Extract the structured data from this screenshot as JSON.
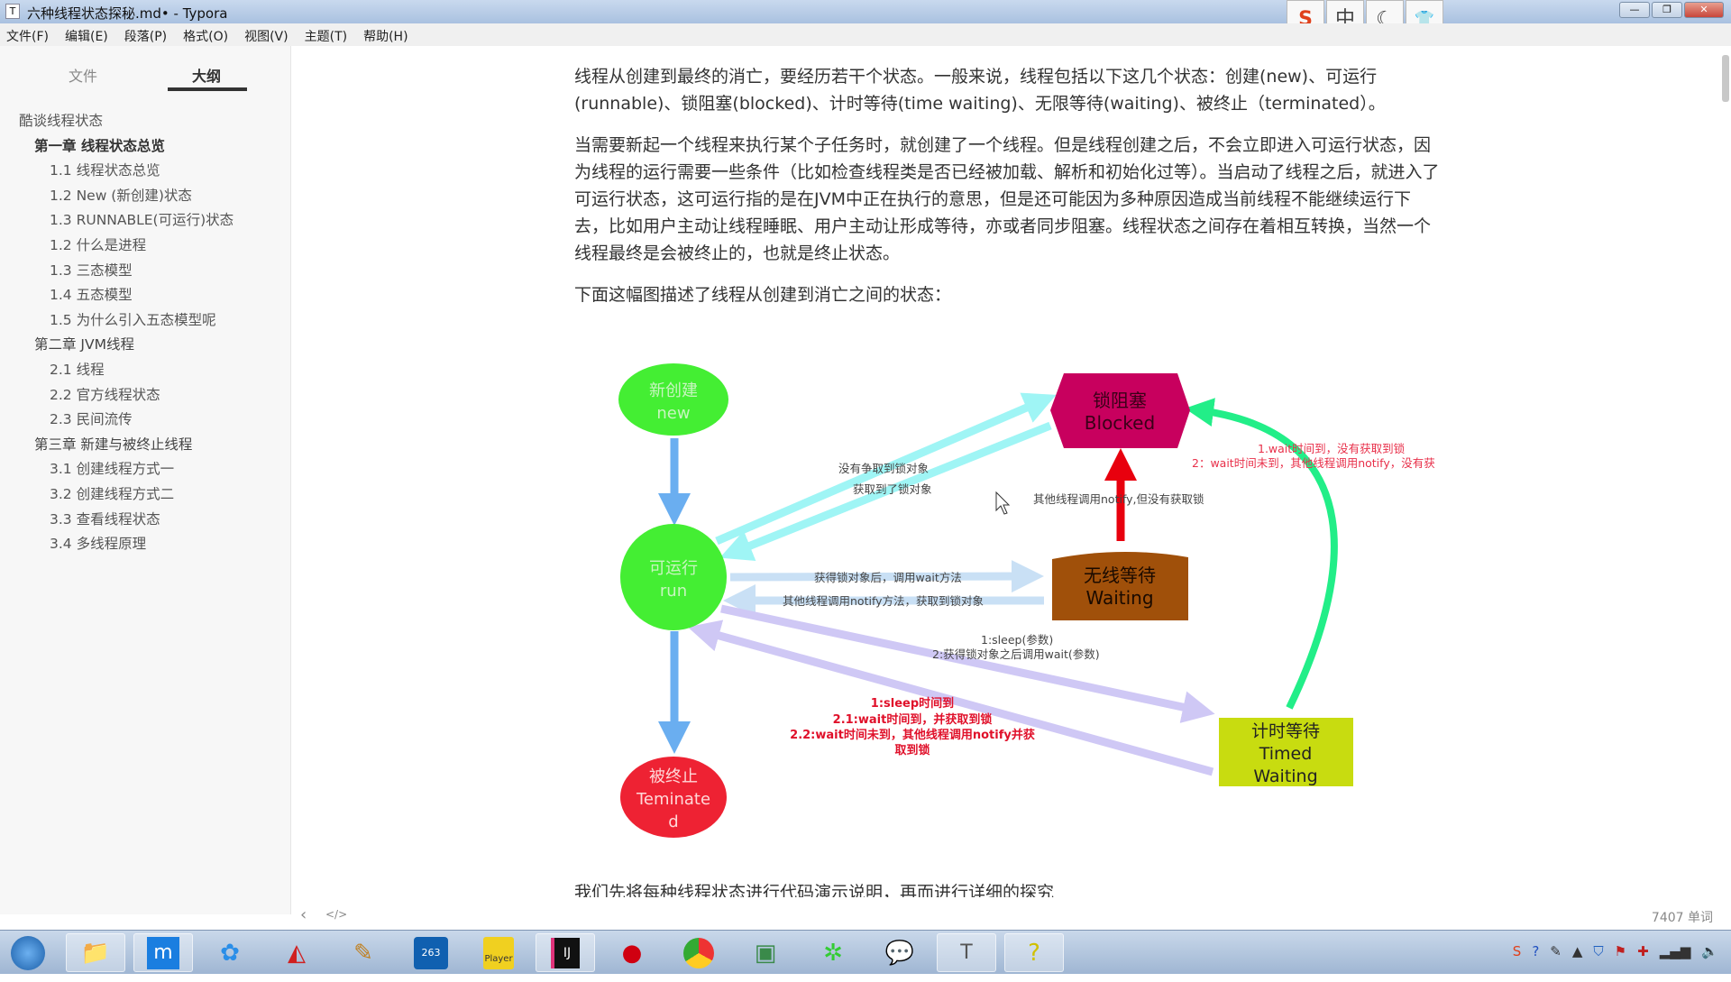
{
  "window": {
    "title": "六种线程状态探秘.md• - Typora",
    "app_icon": "T",
    "controls": [
      "minimize",
      "restore",
      "close"
    ]
  },
  "ime_toolbar": [
    {
      "icon": "sogou-icon",
      "label": "S"
    },
    {
      "icon": "chinese-mode-icon",
      "label": "中"
    },
    {
      "icon": "moon-icon",
      "label": "☾"
    },
    {
      "icon": "skin-icon",
      "label": "👕"
    }
  ],
  "menu": [
    "文件(F)",
    "编辑(E)",
    "段落(P)",
    "格式(O)",
    "视图(V)",
    "主题(T)",
    "帮助(H)"
  ],
  "sidebar": {
    "tabs": [
      {
        "label": "文件",
        "active": false
      },
      {
        "label": "大纲",
        "active": true
      }
    ],
    "outline": [
      {
        "label": "酷谈线程状态",
        "level": 0
      },
      {
        "label": "第一章 线程状态总览",
        "level": 1,
        "active": true
      },
      {
        "label": "1.1 线程状态总览",
        "level": 2
      },
      {
        "label": "1.2 New (新创建)状态",
        "level": 2
      },
      {
        "label": "1.3 RUNNABLE(可运行)状态",
        "level": 2
      },
      {
        "label": "1.2 什么是进程",
        "level": 2
      },
      {
        "label": "1.3 三态模型",
        "level": 2
      },
      {
        "label": "1.4 五态模型",
        "level": 2
      },
      {
        "label": "1.5 为什么引入五态模型呢",
        "level": 2
      },
      {
        "label": "第二章 JVM线程",
        "level": 1
      },
      {
        "label": "2.1 线程",
        "level": 2
      },
      {
        "label": "2.2 官方线程状态",
        "level": 2
      },
      {
        "label": "2.3 民间流传",
        "level": 2
      },
      {
        "label": "第三章 新建与被终止线程",
        "level": 1
      },
      {
        "label": "3.1 创建线程方式一",
        "level": 2
      },
      {
        "label": "3.2 创建线程方式二",
        "level": 2
      },
      {
        "label": "3.3 查看线程状态",
        "level": 2
      },
      {
        "label": "3.4 多线程原理",
        "level": 2
      }
    ]
  },
  "content": {
    "paragraphs": [
      "线程从创建到最终的消亡，要经历若干个状态。一般来说，线程包括以下这几个状态：创建(new)、可运行(runnable)、锁阻塞(blocked)、计时等待(time waiting)、无限等待(waiting)、被终止（terminated）。",
      "当需要新起一个线程来执行某个子任务时，就创建了一个线程。但是线程创建之后，不会立即进入可运行状态，因为线程的运行需要一些条件（比如检查线程类是否已经被加载、解析和初始化过等）。当启动了线程之后，就进入了可运行状态，这可运行指的是在JVM中正在执行的意思，但是还可能因为多种原因造成当前线程不能继续运行下去，比如用户主动让线程睡眠、用户主动让形成等待，亦或者同步阻塞。线程状态之间存在着相互转换，当然一个线程最终是会被终止的，也就是终止状态。",
      "下面这幅图描述了线程从创建到消亡之间的状态："
    ],
    "bottom_text": "我们先将每种线程状态进行代码演示说明，再而进行详细的探究"
  },
  "diagram": {
    "nodes": {
      "new": {
        "line1": "新创建",
        "line2": "new",
        "color": "#44ee33"
      },
      "run": {
        "line1": "可运行",
        "line2": "run",
        "color": "#44ee33"
      },
      "terminated": {
        "line1": "被终止",
        "line2": "Teminate",
        "line3": "d",
        "color": "#ee2233"
      },
      "blocked": {
        "line1": "锁阻塞",
        "line2": "Blocked",
        "color": "#c8005e"
      },
      "waiting": {
        "line1": "无线等待",
        "line2": "Waiting",
        "color": "#a0500a"
      },
      "timed": {
        "line1": "计时等待",
        "line2": "Timed",
        "line3": "Waiting",
        "color": "#c8dc10"
      }
    },
    "labels": {
      "no_lock": "没有争取到锁对象",
      "got_lock": "获取到了锁对象",
      "notify_no_lock": "其他线程调用notify,但没有获取锁",
      "call_wait": "获得锁对象后，调用wait方法",
      "notify_got": "其他线程调用notify方法，获取到锁对象",
      "sleep1": "1:sleep(参数)",
      "sleep2": "2:获得锁对象之后调用wait(参数)",
      "timed_back1": "1:sleep时间到",
      "timed_back2": "2.1:wait时间到，并获取到锁",
      "timed_back3": "2.2:wait时间未到，其他线程调用notify并获",
      "timed_back4": "取到锁",
      "timed_blocked1": "1.wait时间到，没有获取到锁",
      "timed_blocked2": "2：wait时间未到，其他线程调用notify，没有获"
    }
  },
  "statusbar": {
    "word_count": "7407 单词",
    "back_icon": "‹",
    "source_icon": "</>"
  },
  "taskbar": {
    "apps": [
      "start-orb",
      "file-explorer",
      "maxthon",
      "baidu-netdisk",
      "app-red-green",
      "paint-brushes",
      "263-cloud",
      "player",
      "intellij-idea",
      "red-ball",
      "chrome",
      "window-app",
      "atom-app",
      "chat-bubbles",
      "typora",
      "help-doc"
    ]
  }
}
